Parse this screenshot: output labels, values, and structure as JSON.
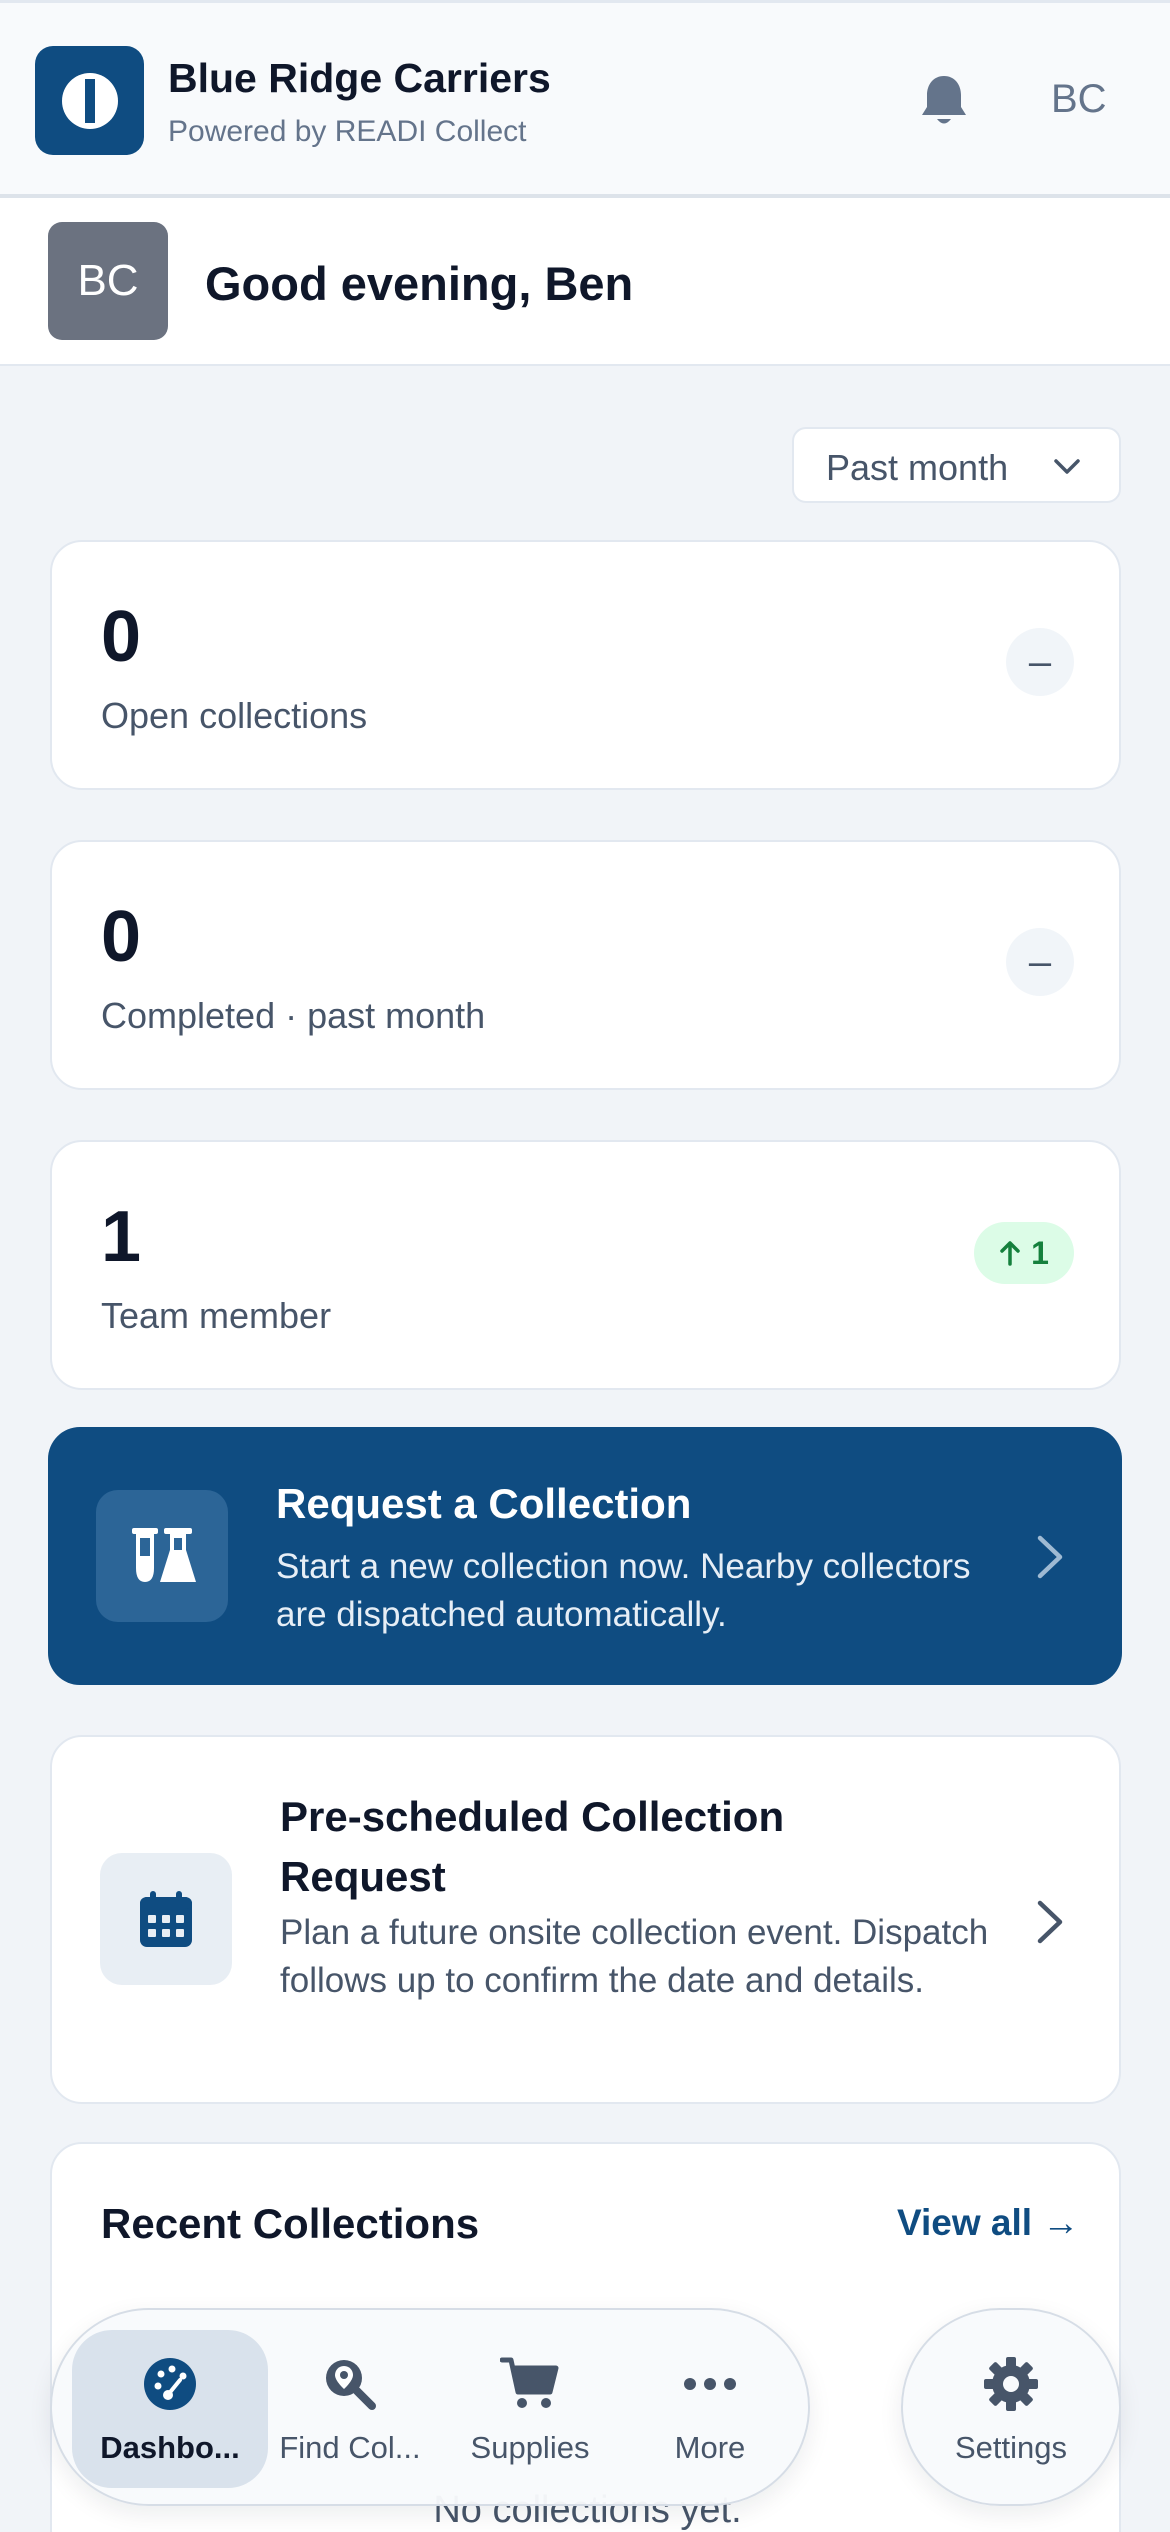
{
  "header": {
    "app_name": "Blue Ridge Carriers",
    "powered_by": "Powered by READI Collect",
    "user_initials": "BC"
  },
  "greeting": {
    "avatar_initials": "BC",
    "text": "Good evening, Ben"
  },
  "period_filter": {
    "selected": "Past month"
  },
  "stats": [
    {
      "value": "0",
      "label": "Open collections",
      "trend": "–"
    },
    {
      "value": "0",
      "label": "Completed · past month",
      "trend": "–"
    },
    {
      "value": "1",
      "label": "Team member",
      "trend": "1",
      "trend_direction": "up"
    }
  ],
  "request_collection": {
    "title": "Request a Collection",
    "description": "Start a new collection now. Nearby collectors are dispatched automatically."
  },
  "prescheduled": {
    "title": "Pre-scheduled Collection Request",
    "description": "Plan a future onsite collection event. Dispatch follows up to confirm the date and details."
  },
  "recent": {
    "title": "Recent Collections",
    "view_all": "View all →",
    "empty": "No collections yet."
  },
  "nav": {
    "items": [
      {
        "label": "Dashbo...",
        "icon": "dashboard-gauge-icon",
        "active": true
      },
      {
        "label": "Find Col...",
        "icon": "map-search-icon",
        "active": false
      },
      {
        "label": "Supplies",
        "icon": "cart-icon",
        "active": false
      },
      {
        "label": "More",
        "icon": "more-dots-icon",
        "active": false
      }
    ],
    "settings_label": "Settings"
  },
  "colors": {
    "brand": "#0f4c81",
    "background": "#f1f4f8",
    "positive": "#15803d",
    "positive_bg": "#dcfce7"
  }
}
